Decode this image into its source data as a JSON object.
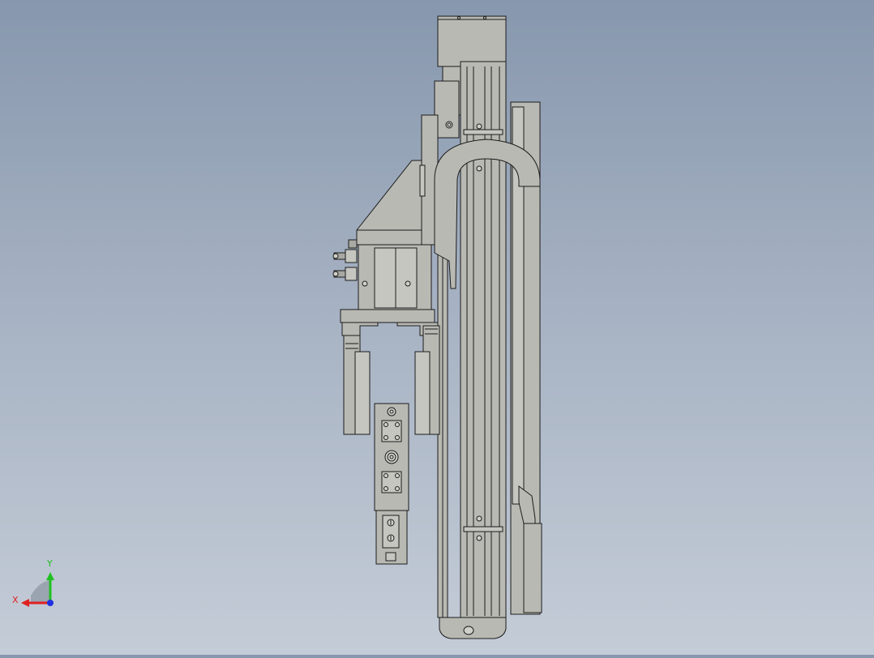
{
  "viewport": {
    "background_top": "#8797ad",
    "background_bottom": "#c4ccd7"
  },
  "model": {
    "body_fill": "#b9b9b3",
    "body_fill_light": "#c6c6c0",
    "edge_color": "#1c1c1c"
  },
  "triad": {
    "x_label": "X",
    "y_label": "Y",
    "x_color": "#e02020",
    "y_color": "#20c020",
    "z_color": "#2030e0"
  }
}
